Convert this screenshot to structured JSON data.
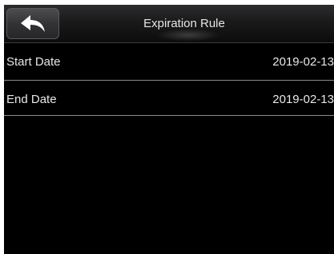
{
  "header": {
    "title": "Expiration Rule",
    "back_icon": "back-arrow-icon"
  },
  "items": [
    {
      "label": "Start Date",
      "value": "2019-02-13"
    },
    {
      "label": "End Date",
      "value": "2019-02-13"
    }
  ],
  "colors": {
    "background": "#000000",
    "text": "#e8e8e8",
    "divider": "#8a8a8a"
  }
}
